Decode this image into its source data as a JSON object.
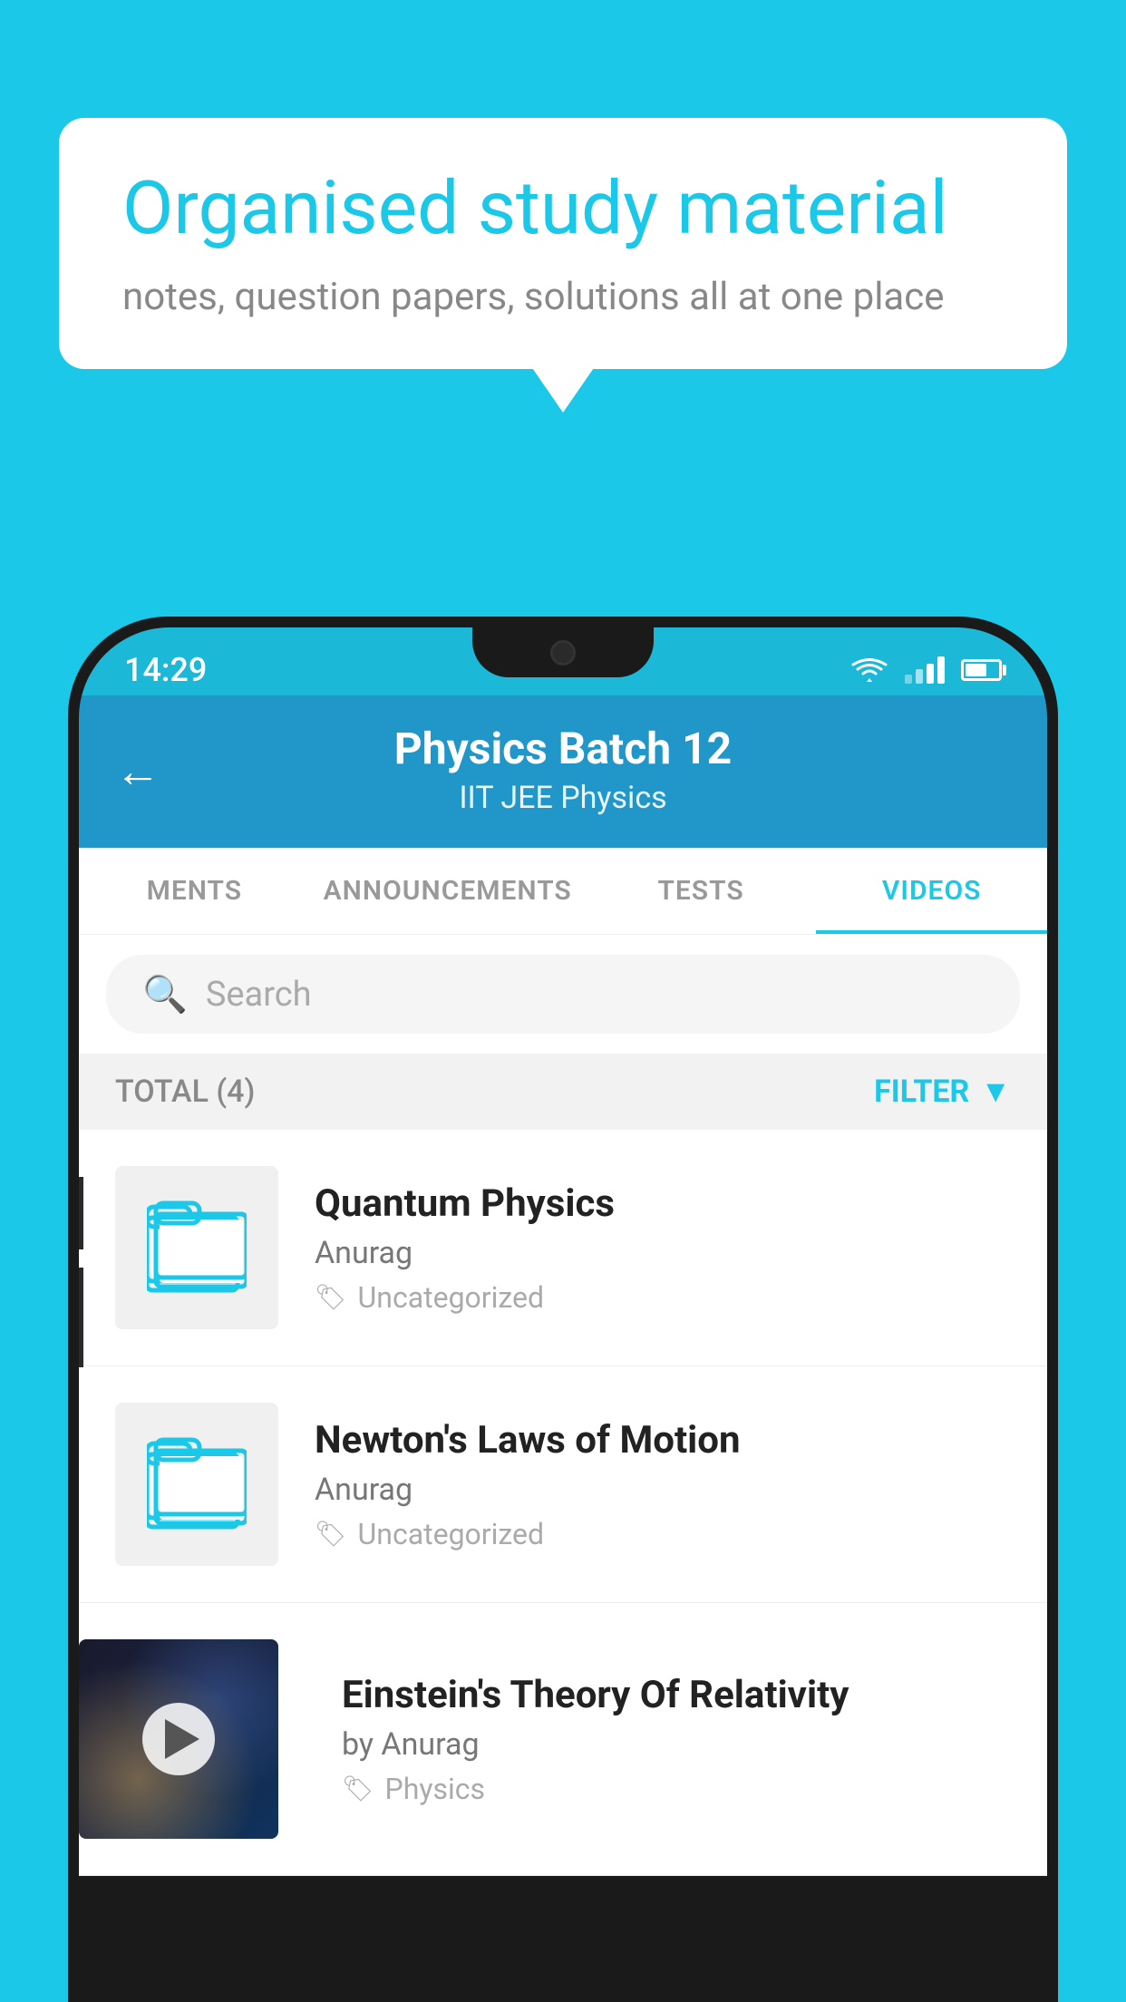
{
  "background": {
    "color": "#1BC8E8"
  },
  "speech_bubble": {
    "title": "Organised study material",
    "subtitle": "notes, question papers, solutions all at one place"
  },
  "status_bar": {
    "time": "14:29"
  },
  "app_header": {
    "back_label": "←",
    "title": "Physics Batch 12",
    "subtitle_part1": "IIT JEE",
    "subtitle_separator": "   ",
    "subtitle_part2": "Physics"
  },
  "tabs": [
    {
      "label": "MENTS",
      "active": false
    },
    {
      "label": "ANNOUNCEMENTS",
      "active": false
    },
    {
      "label": "TESTS",
      "active": false
    },
    {
      "label": "VIDEOS",
      "active": true
    }
  ],
  "search": {
    "placeholder": "Search"
  },
  "filter_bar": {
    "total_label": "TOTAL (4)",
    "filter_label": "FILTER"
  },
  "videos": [
    {
      "id": 1,
      "title": "Quantum Physics",
      "author": "Anurag",
      "tag": "Uncategorized",
      "has_thumbnail": false
    },
    {
      "id": 2,
      "title": "Newton's Laws of Motion",
      "author": "Anurag",
      "tag": "Uncategorized",
      "has_thumbnail": false
    },
    {
      "id": 3,
      "title": "Einstein's Theory Of Relativity",
      "author": "by Anurag",
      "tag": "Physics",
      "has_thumbnail": true
    }
  ]
}
